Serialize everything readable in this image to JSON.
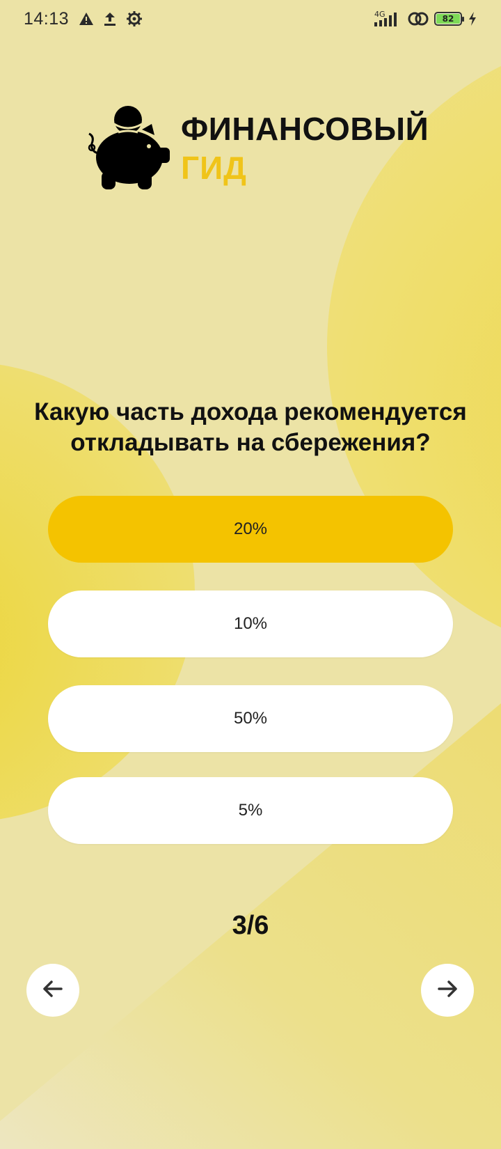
{
  "status_bar": {
    "time": "14:13",
    "network": "4G",
    "battery": "82",
    "icons": [
      "warning-icon",
      "upload-icon",
      "settings-gear-icon",
      "signal-icon",
      "link-icon",
      "battery-icon",
      "charging-icon"
    ]
  },
  "logo": {
    "line1": "ФИНАНСОВЫЙ",
    "line2": "ГИД",
    "icon": "piggy-bank-icon",
    "accent_color": "#f0c419"
  },
  "quiz": {
    "question": "Какую часть дохода рекомендуется откладывать на сбережения?",
    "answers": [
      {
        "label": "20%",
        "selected": true
      },
      {
        "label": "10%",
        "selected": false
      },
      {
        "label": "50%",
        "selected": false
      },
      {
        "label": "5%",
        "selected": false
      }
    ],
    "progress": "3/6",
    "selected_color": "#f4c300"
  },
  "navigation": {
    "prev_icon": "arrow-left-icon",
    "next_icon": "arrow-right-icon"
  }
}
